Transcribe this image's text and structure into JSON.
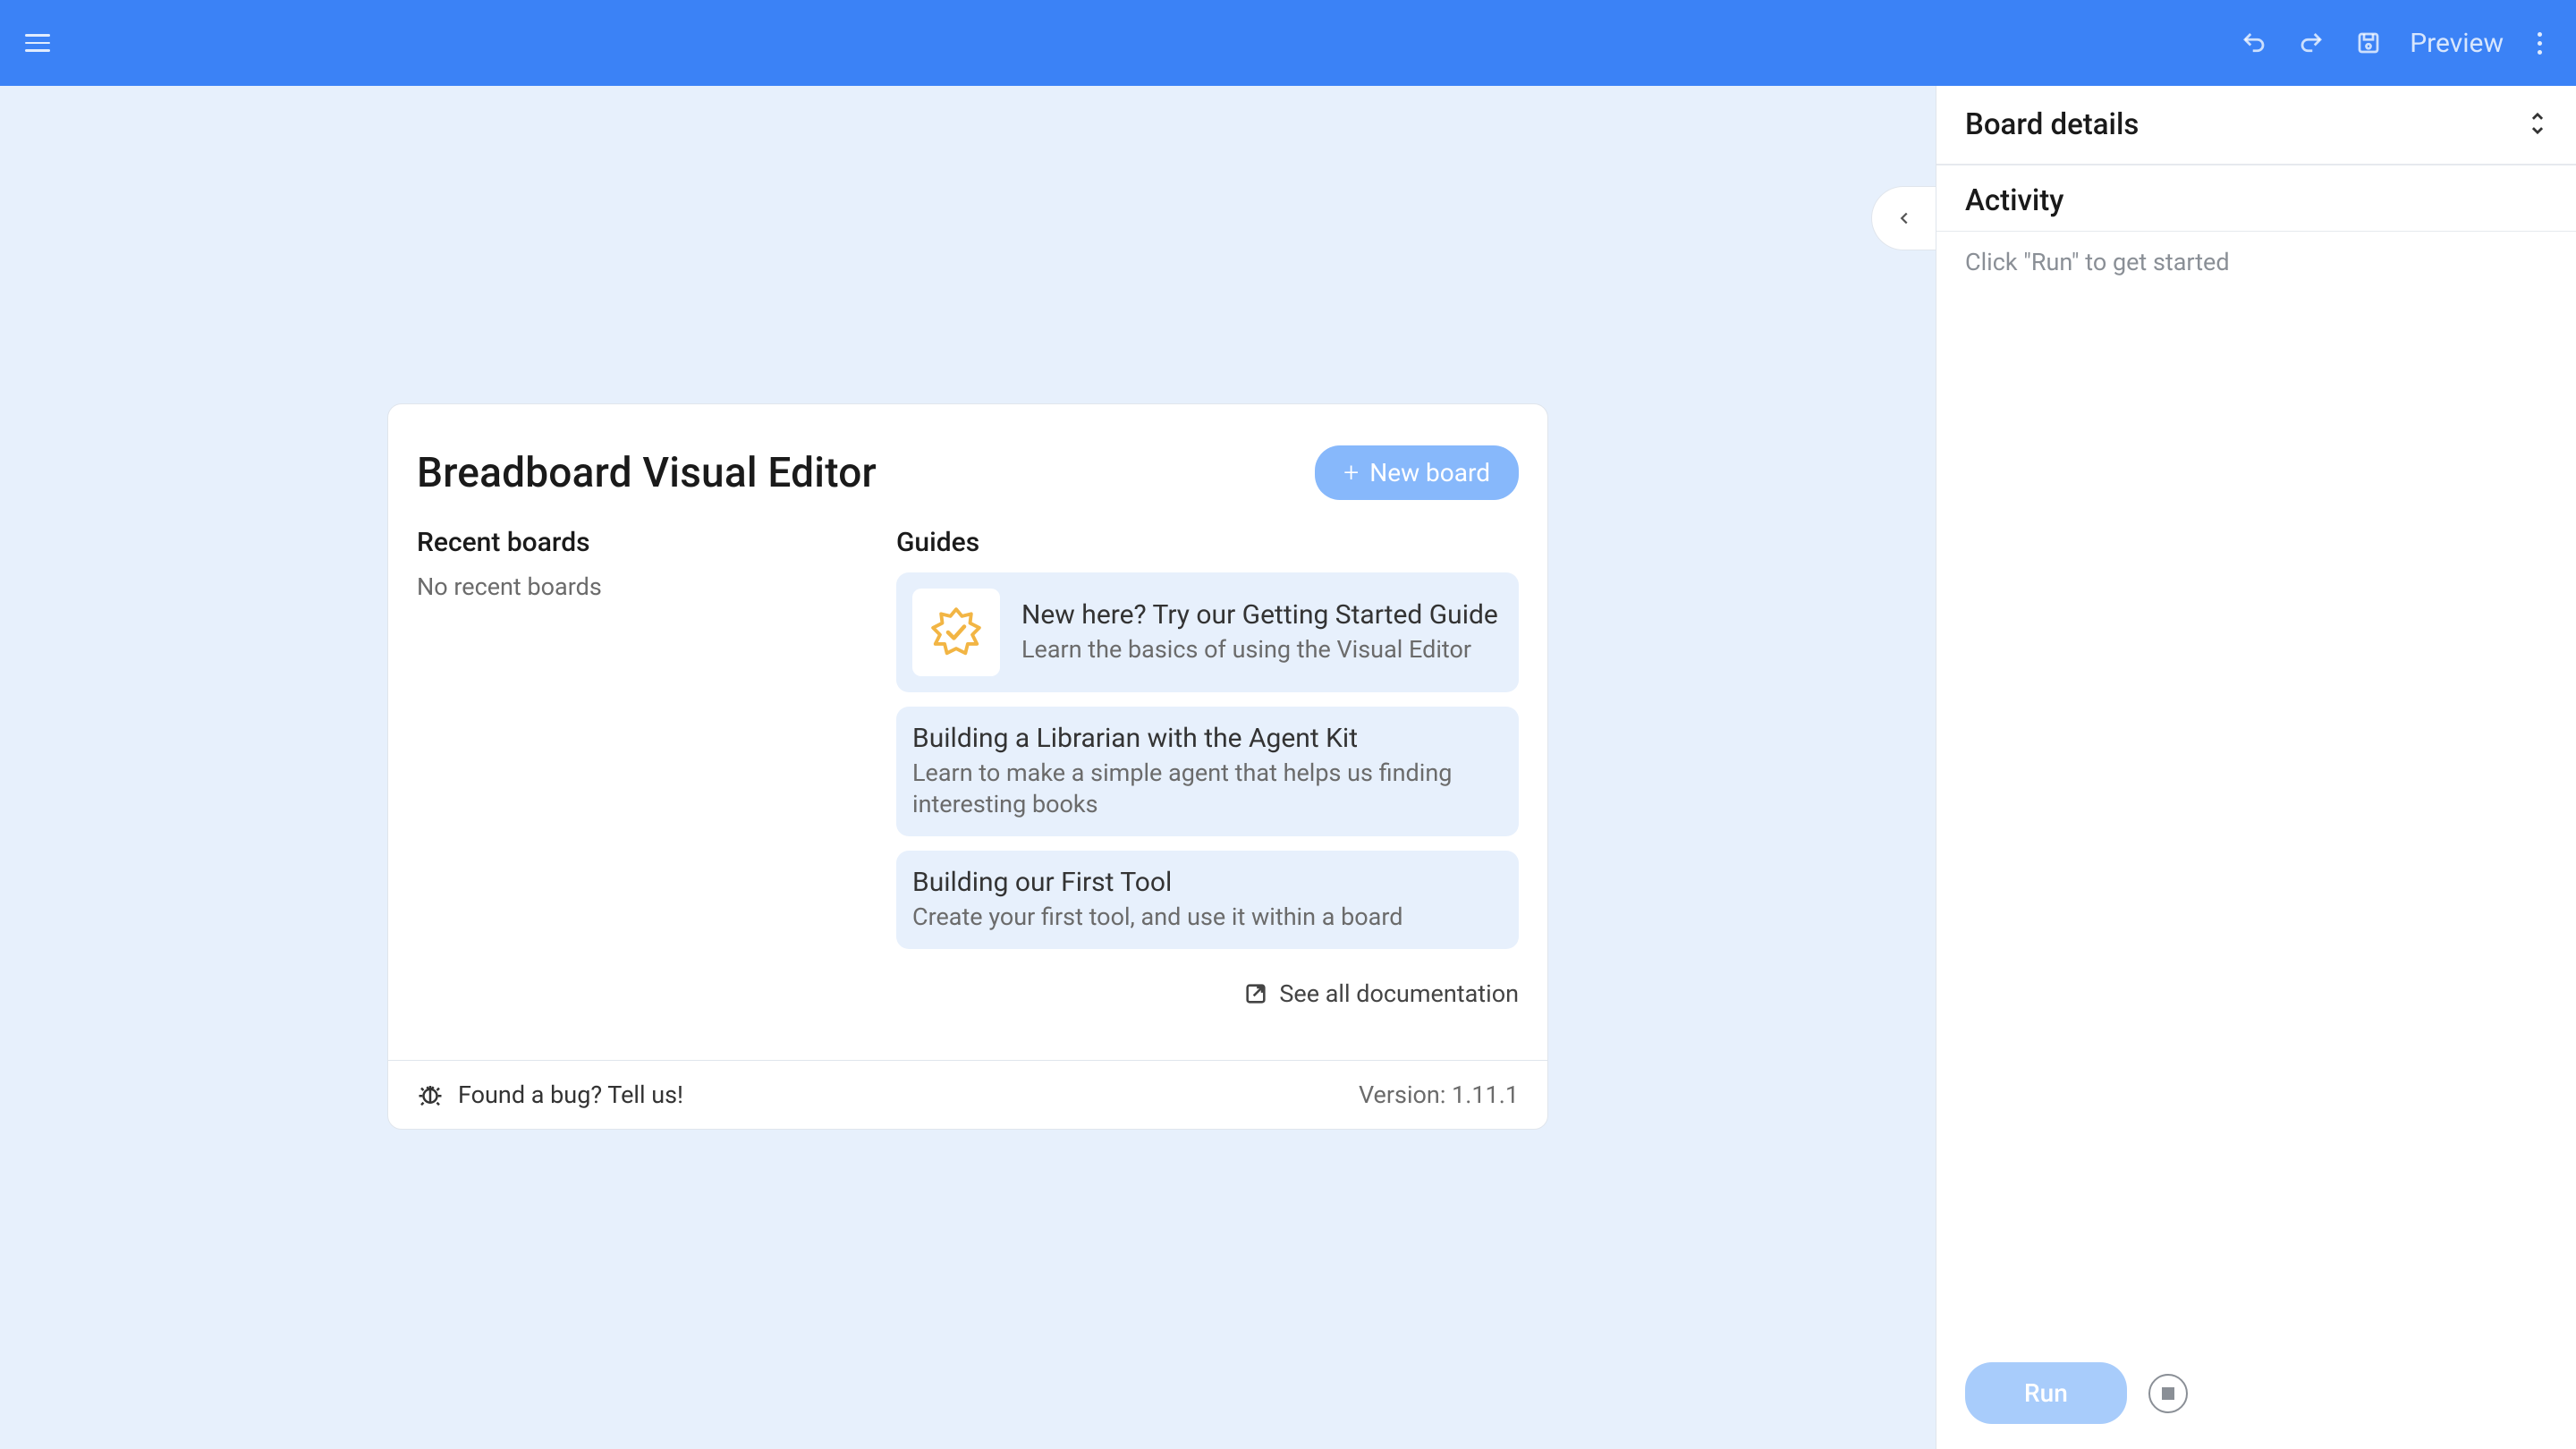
{
  "toolbar": {
    "preview_label": "Preview"
  },
  "welcome": {
    "title": "Breadboard Visual Editor",
    "new_board_label": "New board",
    "recent_heading": "Recent boards",
    "recent_empty": "No recent boards",
    "guides_heading": "Guides",
    "guides": [
      {
        "title": "New here? Try our Getting Started Guide",
        "subtitle": "Learn the basics of using the Visual Editor",
        "has_icon": true
      },
      {
        "title": "Building a Librarian with the Agent Kit",
        "subtitle": "Learn to make a simple agent that helps us finding interesting books",
        "has_icon": false
      },
      {
        "title": "Building our First Tool",
        "subtitle": "Create your first tool, and use it within a board",
        "has_icon": false
      }
    ],
    "see_all_label": "See all documentation",
    "bug_label": "Found a bug? Tell us!",
    "version_label": "Version: 1.11.1"
  },
  "panel": {
    "title": "Board details",
    "activity_title": "Activity",
    "activity_hint": "Click \"Run\" to get started",
    "run_label": "Run"
  }
}
